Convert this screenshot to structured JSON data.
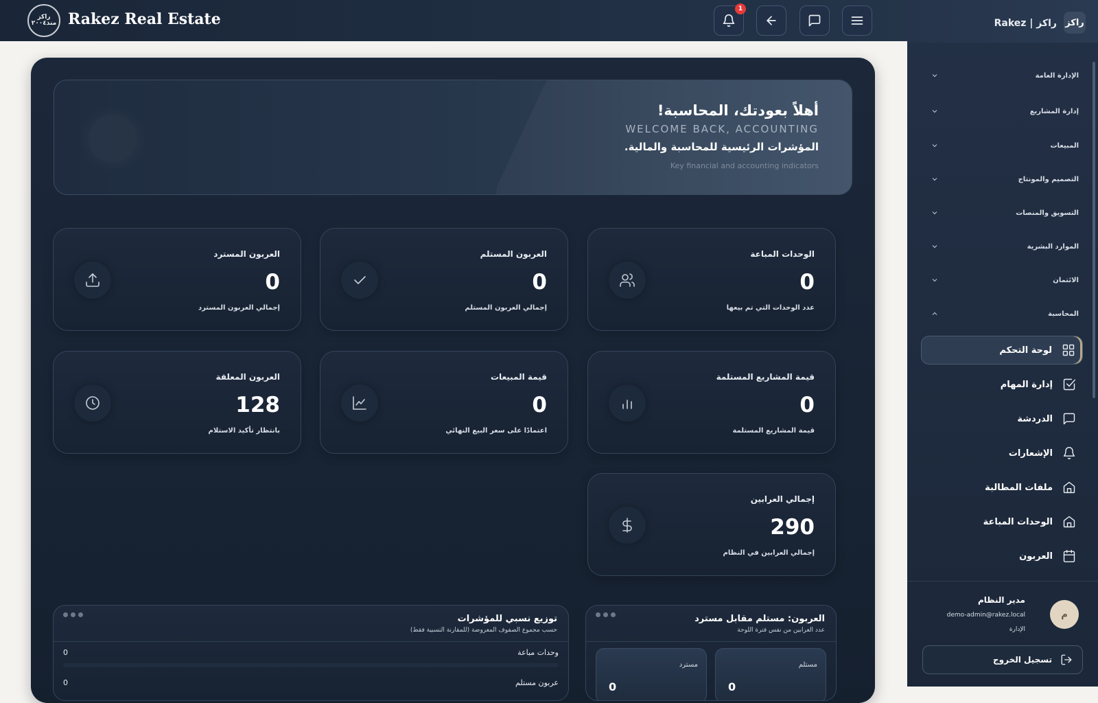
{
  "header": {
    "logo_text": "راكز\nمنذ ٢٠٠٤",
    "brand_title": "Rakez Real Estate",
    "notification_count": "1"
  },
  "hero": {
    "greeting": "أهلاً بعودتك، المحاسبة!",
    "greeting_en": "WELCOME BACK, ACCOUNTING",
    "subtitle": "المؤشرات الرئيسية للمحاسبة والمالية.",
    "subtitle_en": "Key financial and accounting indicators"
  },
  "cards": [
    {
      "title": "الوحدات المباعة",
      "value": "0",
      "desc": "عدد الوحدات التي تم بيعها",
      "icon": "users-icon"
    },
    {
      "title": "العربون المستلم",
      "value": "0",
      "desc": "إجمالي العربون المستلم",
      "icon": "check-icon"
    },
    {
      "title": "العربون المسترد",
      "value": "0",
      "desc": "إجمالي العربون المسترد",
      "icon": "upload-icon"
    },
    {
      "title": "قيمة المشاريع المستلمة",
      "value": "0",
      "desc": "قيمة المشاريع المستلمة",
      "icon": "bar-chart-icon"
    },
    {
      "title": "قيمة المبيعات",
      "value": "0",
      "desc": "اعتمادًا على سعر البيع النهائي",
      "icon": "line-chart-icon"
    },
    {
      "title": "العربون المعلقة",
      "value": "128",
      "desc": "بانتظار تأكيد الاستلام",
      "icon": "clock-icon"
    },
    {
      "title": "إجمالي العرابين",
      "value": "290",
      "desc": "إجمالي العرابين في النظام",
      "icon": "dollar-icon"
    }
  ],
  "panel_deposits": {
    "title": "العربون: مستلم مقابل مسترد",
    "subtitle": "عدد العرابين من نفس فترة اللوحة",
    "received_label": "مستلم",
    "refunded_label": "مسترد",
    "received_value": "0",
    "refunded_value": "0"
  },
  "panel_distribution": {
    "title": "توزيع نسبي للمؤشرات",
    "subtitle": "حسب مجموع الصفوف المعروضة (للمقارنة النسبية فقط)",
    "rows": [
      {
        "label": "وحدات مباعة",
        "value": "0"
      },
      {
        "label": "عربون مستلم",
        "value": "0"
      }
    ]
  },
  "sidebar": {
    "logo": "راكز",
    "brand": "Rakez | راكز",
    "sections": [
      {
        "label": "الإدارة العامة",
        "expanded": false
      },
      {
        "label": "إدارة المشاريع",
        "expanded": false
      },
      {
        "label": "المبيعات",
        "expanded": false
      },
      {
        "label": "التصميم والمونتاج",
        "expanded": false
      },
      {
        "label": "التسويق والمنصات",
        "expanded": false
      },
      {
        "label": "الموارد البشرية",
        "expanded": false
      },
      {
        "label": "الائتمان",
        "expanded": false
      },
      {
        "label": "المحاسبة",
        "expanded": true
      }
    ],
    "items": [
      {
        "label": "لوحة التحكم",
        "icon": "grid-icon",
        "active": true
      },
      {
        "label": "إدارة المهام",
        "icon": "task-check-icon"
      },
      {
        "label": "الدردشة",
        "icon": "chat-icon"
      },
      {
        "label": "الإشعارات",
        "icon": "bell-icon"
      },
      {
        "label": "ملفات المطالبة",
        "icon": "home-icon"
      },
      {
        "label": "الوحدات المباعة",
        "icon": "home-icon"
      },
      {
        "label": "العربون",
        "icon": "calendar-icon"
      }
    ],
    "user": {
      "initial": "م",
      "name": "مدير النظام",
      "email": "demo-admin@rakez.local",
      "role": "الإدارة"
    },
    "logout_label": "تسجيل الخروج"
  }
}
